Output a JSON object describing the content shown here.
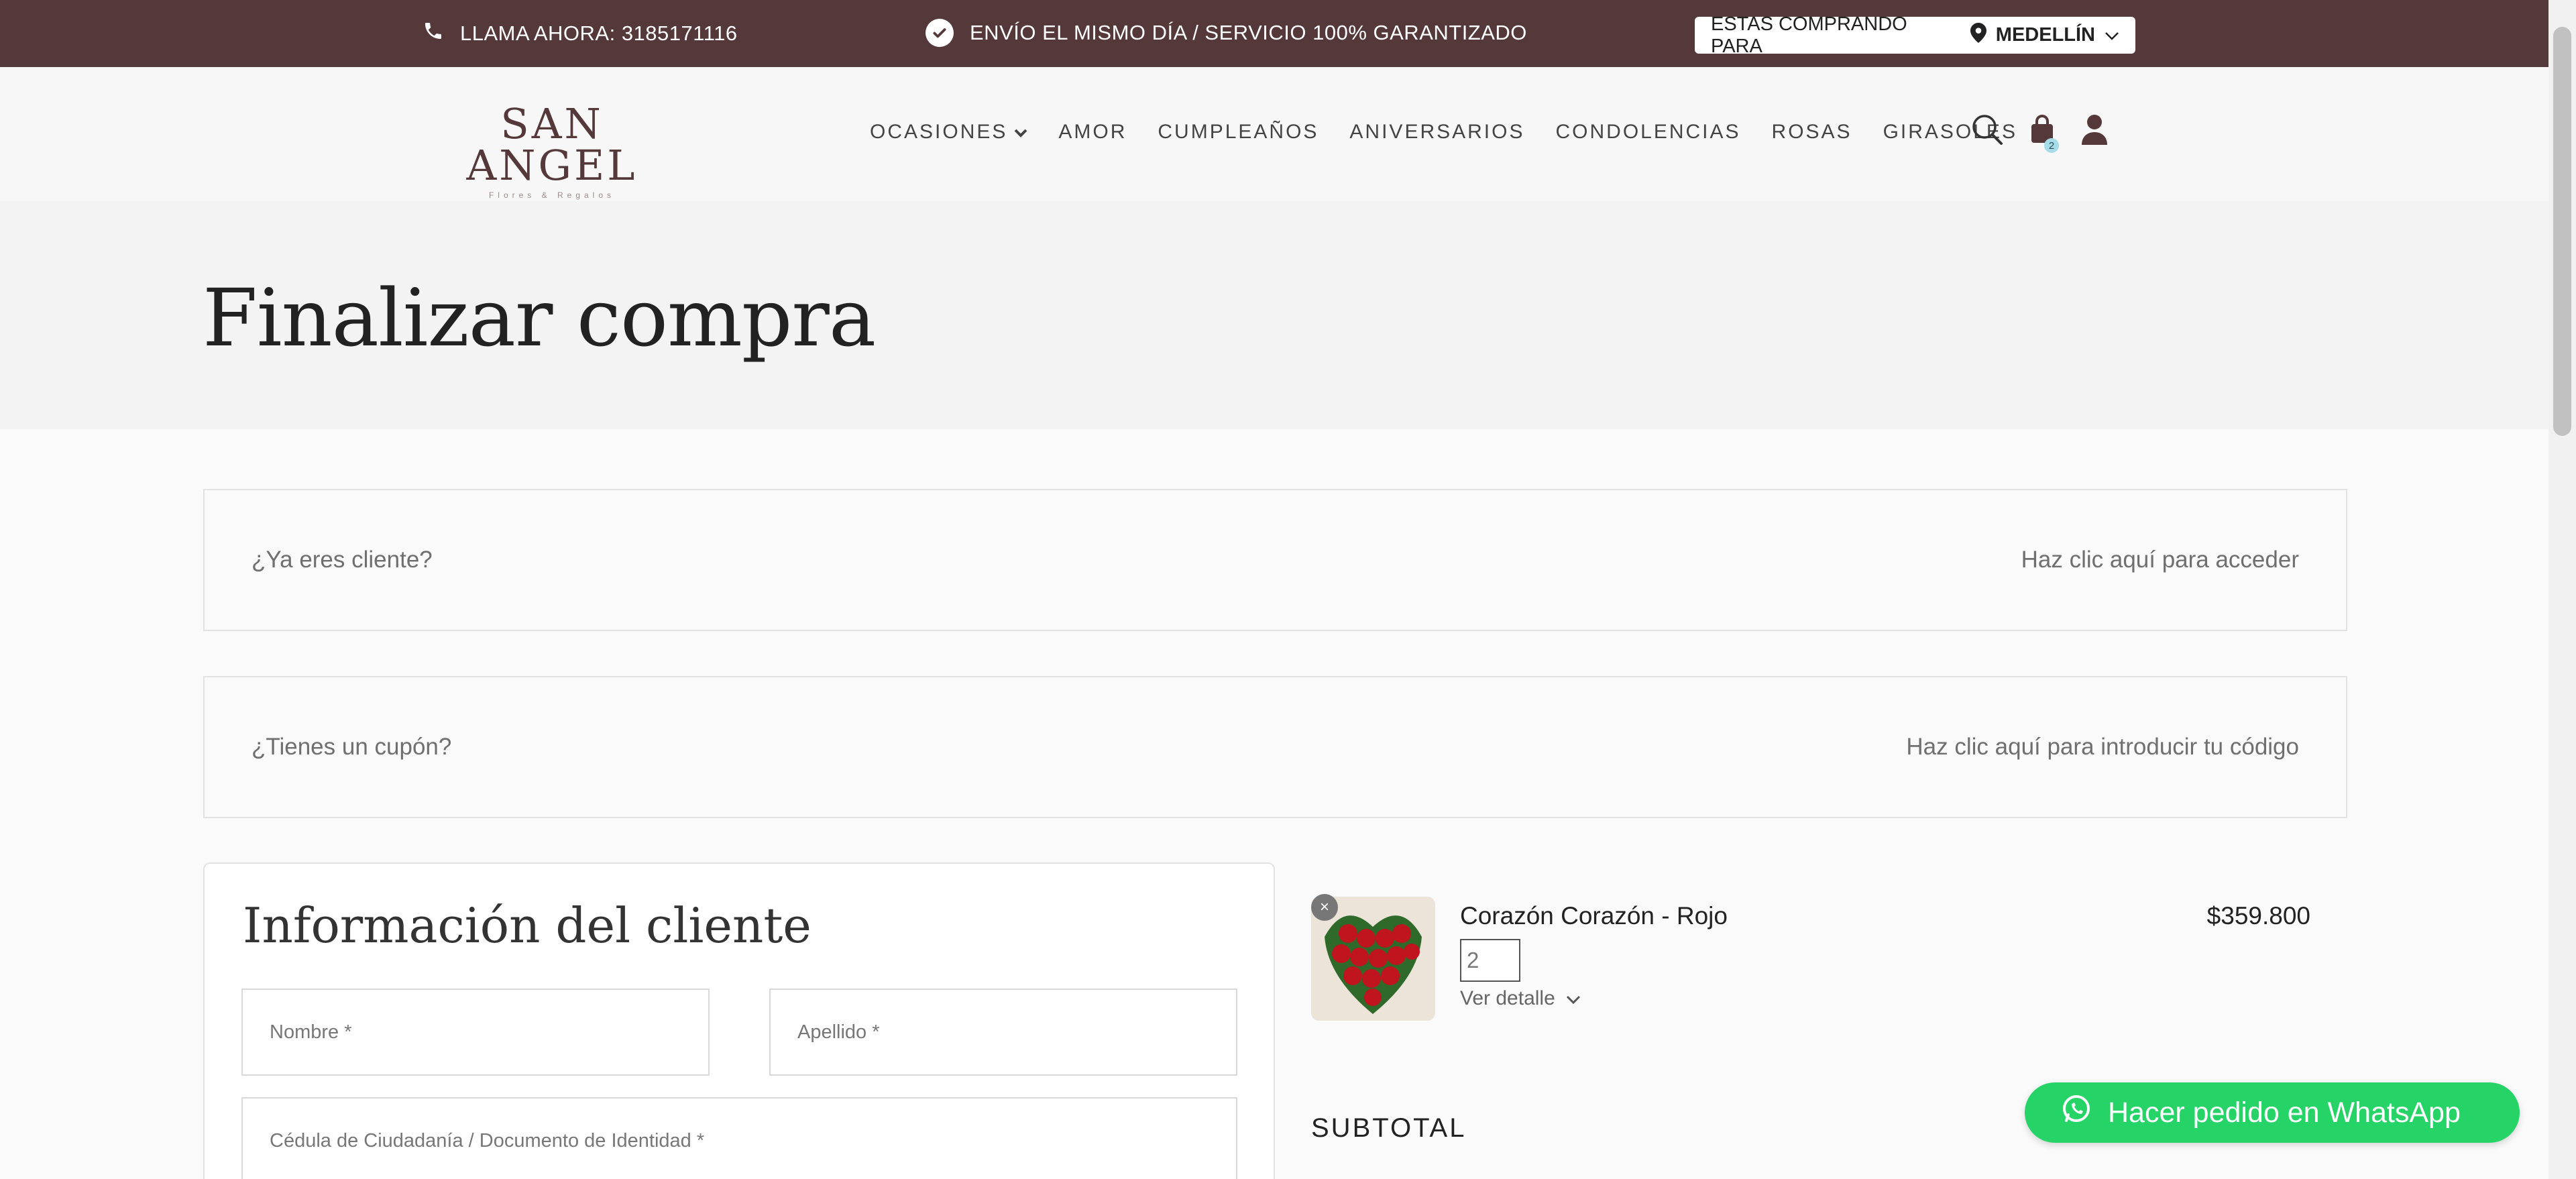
{
  "topbar": {
    "phone_text": "LLAMA AHORA: 3185171116",
    "shipping_text": "ENVÍO EL MISMO DÍA / SERVICIO 100% GARANTIZADO",
    "city_prefix": "ESTAS COMPRANDO PARA",
    "city": "MEDELLÍN",
    "bg_color": "#55383a"
  },
  "header": {
    "logo_text": "SAN ANGEL",
    "logo_tagline": "Flores & Regalos",
    "nav": [
      {
        "label": "OCASIONES"
      },
      {
        "label": "AMOR"
      },
      {
        "label": "CUMPLEAÑOS"
      },
      {
        "label": "ANIVERSARIOS"
      },
      {
        "label": "CONDOLENCIAS"
      },
      {
        "label": "ROSAS"
      },
      {
        "label": "GIRASOLES"
      }
    ],
    "cart_count": "2"
  },
  "page": {
    "title": "Finalizar compra"
  },
  "notices": {
    "login_question": "¿Ya eres cliente?",
    "login_link": "Haz clic aquí para acceder",
    "coupon_question": "¿Tienes un cupón?",
    "coupon_link": "Haz clic aquí para introducir tu código"
  },
  "customer_info": {
    "title": "Información del cliente",
    "first_name_label": "Nombre *",
    "last_name_label": "Apellido *",
    "id_label": "Cédula de Ciudadanía / Documento de Identidad *"
  },
  "order": {
    "product_name": "Corazón Corazón - Rojo",
    "product_price": "$359.800",
    "quantity": "2",
    "details_label": "Ver detalle",
    "subtotal_label": "SUBTOTAL"
  },
  "whatsapp": {
    "label": "Hacer pedido en WhatsApp",
    "color": "#25d366"
  }
}
